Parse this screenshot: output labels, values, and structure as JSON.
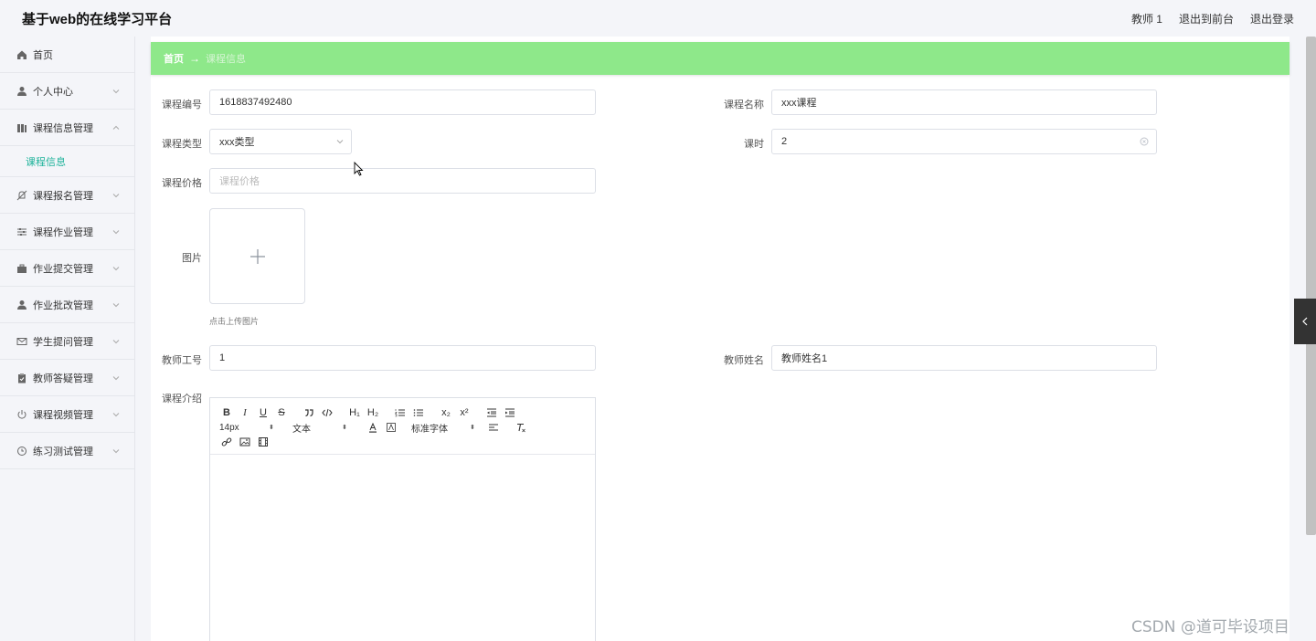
{
  "header": {
    "brand": "基于web的在线学习平台",
    "user": "教师 1",
    "back_front": "退出到前台",
    "logout": "退出登录"
  },
  "sidebar": {
    "items": [
      {
        "label": "首页",
        "icon": "home-icon"
      },
      {
        "label": "个人中心",
        "icon": "user-icon"
      },
      {
        "label": "课程信息管理",
        "icon": "book-icon",
        "expanded": true,
        "sub": "课程信息"
      },
      {
        "label": "课程报名管理",
        "icon": "bell-off-icon"
      },
      {
        "label": "课程作业管理",
        "icon": "sliders-icon"
      },
      {
        "label": "作业提交管理",
        "icon": "briefcase-icon"
      },
      {
        "label": "作业批改管理",
        "icon": "user-icon"
      },
      {
        "label": "学生提问管理",
        "icon": "mail-icon"
      },
      {
        "label": "教师答疑管理",
        "icon": "clipboard-icon"
      },
      {
        "label": "课程视频管理",
        "icon": "power-icon"
      },
      {
        "label": "练习测试管理",
        "icon": "clock-icon"
      }
    ]
  },
  "breadcrumb": {
    "home": "首页",
    "arrow": "→",
    "current": "课程信息"
  },
  "form": {
    "course_no_label": "课程编号",
    "course_no_value": "1618837492480",
    "course_name_label": "课程名称",
    "course_name_value": "xxx课程",
    "course_type_label": "课程类型",
    "course_type_value": "xxx类型",
    "hours_label": "课时",
    "hours_value": "2",
    "price_label": "课程价格",
    "price_placeholder": "课程价格",
    "image_label": "图片",
    "upload_tip": "点击上传图片",
    "teacher_no_label": "教师工号",
    "teacher_no_value": "1",
    "teacher_name_label": "教师姓名",
    "teacher_name_value": "教师姓名1",
    "intro_label": "课程介绍"
  },
  "editor": {
    "font_size": "14px",
    "text_style": "文本",
    "font_family": "标准字体",
    "sub": "x₂",
    "sup": "x²",
    "h1": "H₁",
    "h2": "H₂",
    "bold": "B",
    "italic": "I",
    "underline": "U",
    "strike": "S"
  },
  "watermark": "CSDN @道可毕设项目"
}
